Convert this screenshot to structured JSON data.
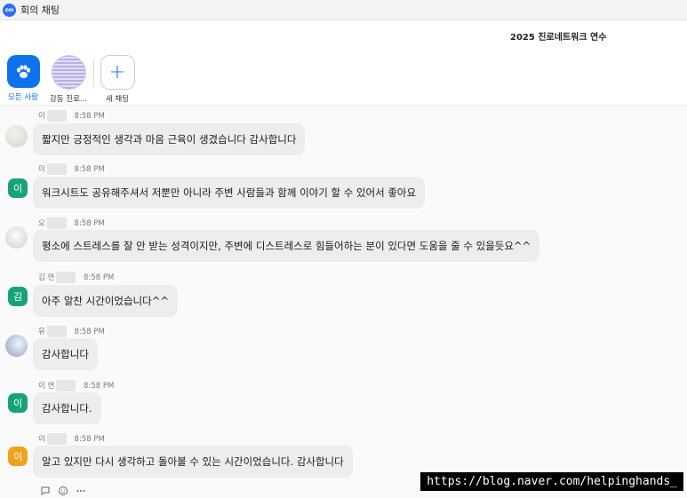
{
  "window": {
    "app_icon_text": "zm",
    "title": "회의 채팅"
  },
  "meeting_title": "2025 진로네트워크 연수",
  "chips": [
    {
      "label": "모든 사람",
      "icon": "paw-icon"
    },
    {
      "label": "강동 진로...",
      "icon": "group-avatar"
    },
    {
      "label": "새 채팅",
      "icon": "plus-icon",
      "symbol": "+"
    }
  ],
  "messages": [
    {
      "name": "이",
      "time": "8:58 PM",
      "text": "짧지만 긍정적인 생각과 마음 근육이 생겼습니다 감사합니다",
      "avatar_type": "photo",
      "avatar_color": "#e4e1dc"
    },
    {
      "name": "이",
      "time": "8:58 PM",
      "text": "워크시트도 공유해주셔서 저뿐만 아니라 주변 사람들과 함께 이야기 할 수 있어서 좋아요",
      "avatar_type": "letter",
      "avatar_letter": "이",
      "avatar_color": "#17a37a"
    },
    {
      "name": "오",
      "time": "8:58 PM",
      "text": "평소에 스트레스를 잘 안 받는 성격이지만, 주변에 디스트레스로 힘들어하는 분이 있다면 도움을 줄 수 있을듯요^^",
      "avatar_type": "photo",
      "avatar_color": "#d9d9dc"
    },
    {
      "name": "김 연",
      "time": "8:58 PM",
      "text": "아주 알찬 시간이었습니다^^",
      "avatar_type": "letter",
      "avatar_letter": "김",
      "avatar_color": "#17a37a"
    },
    {
      "name": "유",
      "time": "8:58 PM",
      "text": "감사합니다",
      "avatar_type": "photo",
      "avatar_color": "#b8c6da"
    },
    {
      "name": "이 연",
      "time": "8:58 PM",
      "text": "감사합니다.",
      "avatar_type": "letter",
      "avatar_letter": "이",
      "avatar_color": "#17a37a"
    },
    {
      "name": "이",
      "time": "8:58 PM",
      "text": "알고 있지만 다시 생각하고 돌아볼 수 있는 시간이었습니다. 감사합니다",
      "avatar_type": "letter",
      "avatar_letter": "이",
      "avatar_color": "#f0a21c"
    }
  ],
  "watermark": "https://blog.naver.com/helpinghands_",
  "accent_color": "#0e72ed"
}
